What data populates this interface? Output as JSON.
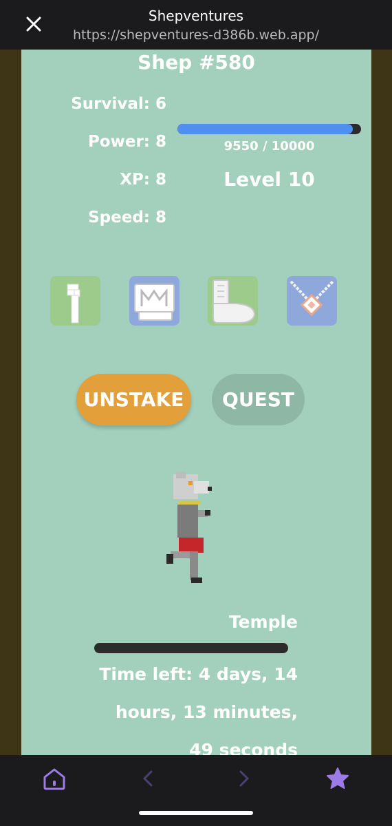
{
  "browser": {
    "title": "Shepventures",
    "url": "https://shepventures-d386b.web.app/"
  },
  "shep": {
    "name": "Shep #580",
    "stats": {
      "survival": "Survival: 6",
      "power": "Power: 8",
      "xp": "XP: 8",
      "speed": "Speed: 8"
    },
    "xp_progress": {
      "text": "9550 / 10000",
      "fraction": 0.955
    },
    "level": "Level 10"
  },
  "items": [
    {
      "icon": "cane-icon",
      "bg": "#9ccb8c"
    },
    {
      "icon": "boots-icon",
      "bg": "#8fa8dc"
    },
    {
      "icon": "glove-icon",
      "bg": "#9ccb8c"
    },
    {
      "icon": "necklace-icon",
      "bg": "#8fa8dc"
    }
  ],
  "buttons": {
    "unstake": "UNSTAKE",
    "quest": "QUEST"
  },
  "quest_status": {
    "location": "Temple",
    "progress_fraction": 0,
    "time_left": "Time left: 4 days, 14 hours, 13 minutes, 49 seconds"
  },
  "colors": {
    "page_bg": "#a3d0bd",
    "accent_orange": "#e3a03a",
    "progress_blue": "#4f8ff0",
    "nav_purple": "#9d7be6"
  }
}
